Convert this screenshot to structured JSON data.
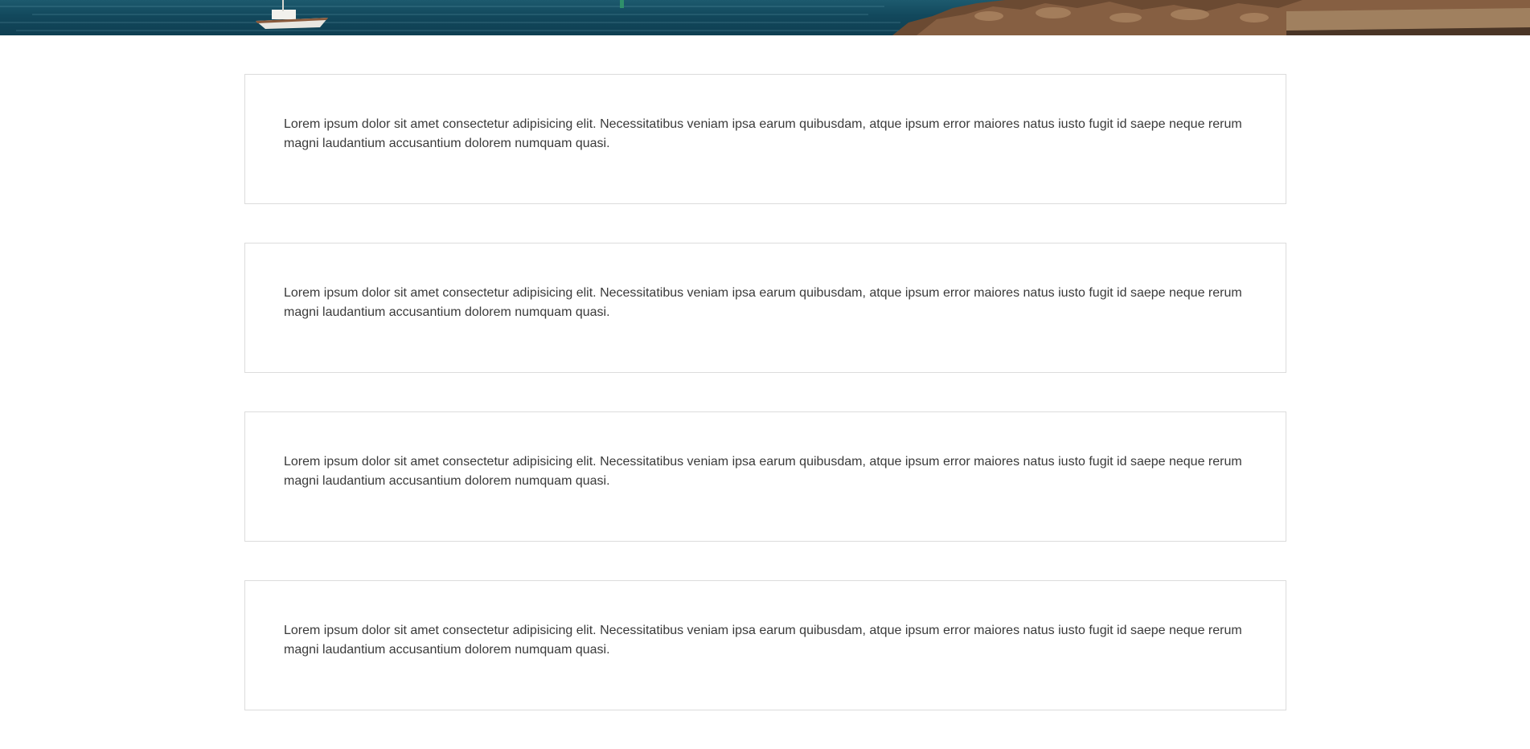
{
  "colors": {
    "sea_dark": "#0f3f52",
    "sea_mid": "#1d5a6e",
    "rocks": "#6b4a32",
    "card_border": "#dcdcdc",
    "text": "#3a3a3a"
  },
  "hero": {
    "icon": "harbor-photo"
  },
  "cards": [
    {
      "text": "Lorem ipsum dolor sit amet consectetur adipisicing elit. Necessitatibus veniam ipsa earum quibusdam, atque ipsum error maiores natus iusto fugit id saepe neque rerum magni laudantium accusantium dolorem numquam quasi."
    },
    {
      "text": "Lorem ipsum dolor sit amet consectetur adipisicing elit. Necessitatibus veniam ipsa earum quibusdam, atque ipsum error maiores natus iusto fugit id saepe neque rerum magni laudantium accusantium dolorem numquam quasi."
    },
    {
      "text": "Lorem ipsum dolor sit amet consectetur adipisicing elit. Necessitatibus veniam ipsa earum quibusdam, atque ipsum error maiores natus iusto fugit id saepe neque rerum magni laudantium accusantium dolorem numquam quasi."
    },
    {
      "text": "Lorem ipsum dolor sit amet consectetur adipisicing elit. Necessitatibus veniam ipsa earum quibusdam, atque ipsum error maiores natus iusto fugit id saepe neque rerum magni laudantium accusantium dolorem numquam quasi."
    }
  ]
}
